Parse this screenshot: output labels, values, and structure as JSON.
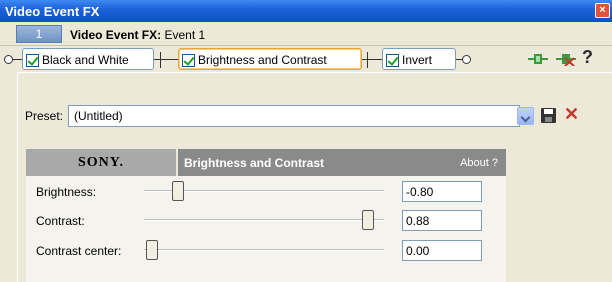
{
  "window": {
    "title": "Video Event FX",
    "close_glyph": "×"
  },
  "event": {
    "number": "1",
    "label_bold": "Video Event FX:",
    "label_rest": "Event 1"
  },
  "chain": {
    "plugins": [
      {
        "name": "Black and White",
        "checked": true
      },
      {
        "name": "Brightness and Contrast",
        "checked": true,
        "active": true
      },
      {
        "name": "Invert",
        "checked": true
      }
    ],
    "tools": {
      "add_plugin_icon": "plugin-add-icon",
      "remove_plugin_icon": "plugin-remove-icon",
      "help": "?"
    }
  },
  "preset": {
    "label": "Preset:",
    "value": "(Untitled)",
    "save_icon": "save-icon",
    "delete_icon": "delete-icon",
    "delete_glyph": "✕"
  },
  "plugin_header": {
    "brand": "SONY.",
    "title": "Brightness and Contrast",
    "about": "About  ?"
  },
  "params": [
    {
      "label": "Brightness:",
      "value": "-0.80"
    },
    {
      "label": "Contrast:",
      "value": "0.88"
    },
    {
      "label": "Contrast center:",
      "value": "0.00"
    }
  ],
  "colors": {
    "titlebar": "#0a4fc9",
    "active_outline": "#e8a33c",
    "check": "#21a121",
    "delete": "#c0392b"
  }
}
